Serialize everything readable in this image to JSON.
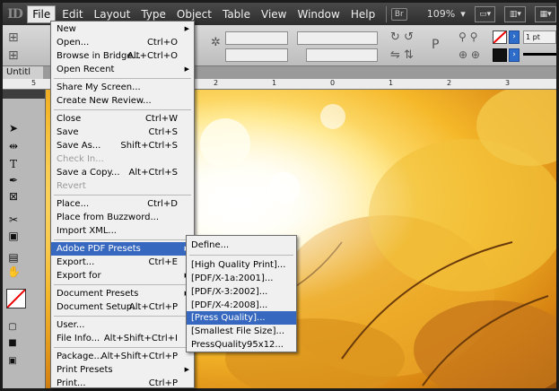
{
  "menubar": {
    "app_logo": "ID",
    "items": [
      "File",
      "Edit",
      "Layout",
      "Type",
      "Object",
      "Table",
      "View",
      "Window",
      "Help"
    ],
    "bridge_badge": "Br",
    "zoom": "109%",
    "stroke_weight": "1 pt"
  },
  "document": {
    "tab_title": "Untitl"
  },
  "ruler": {
    "labels": [
      "5",
      "2",
      "1",
      "0",
      "1",
      "2",
      "3"
    ]
  },
  "file_menu": {
    "items": [
      {
        "label": "New",
        "shortcut": "",
        "submenu": true,
        "disabled": false
      },
      {
        "label": "Open...",
        "shortcut": "Ctrl+O",
        "submenu": false,
        "disabled": false
      },
      {
        "label": "Browse in Bridge...",
        "shortcut": "Alt+Ctrl+O",
        "submenu": false,
        "disabled": false
      },
      {
        "label": "Open Recent",
        "shortcut": "",
        "submenu": true,
        "disabled": false
      },
      {
        "label": "Share My Screen...",
        "shortcut": "",
        "submenu": false,
        "disabled": false
      },
      {
        "label": "Create New Review...",
        "shortcut": "",
        "submenu": false,
        "disabled": false
      },
      {
        "label": "Close",
        "shortcut": "Ctrl+W",
        "submenu": false,
        "disabled": false
      },
      {
        "label": "Save",
        "shortcut": "Ctrl+S",
        "submenu": false,
        "disabled": false
      },
      {
        "label": "Save As...",
        "shortcut": "Shift+Ctrl+S",
        "submenu": false,
        "disabled": false
      },
      {
        "label": "Check In...",
        "shortcut": "",
        "submenu": false,
        "disabled": true
      },
      {
        "label": "Save a Copy...",
        "shortcut": "Alt+Ctrl+S",
        "submenu": false,
        "disabled": false
      },
      {
        "label": "Revert",
        "shortcut": "",
        "submenu": false,
        "disabled": true
      },
      {
        "label": "Place...",
        "shortcut": "Ctrl+D",
        "submenu": false,
        "disabled": false
      },
      {
        "label": "Place from Buzzword...",
        "shortcut": "",
        "submenu": false,
        "disabled": false
      },
      {
        "label": "Import XML...",
        "shortcut": "",
        "submenu": false,
        "disabled": false
      },
      {
        "label": "Adobe PDF Presets",
        "shortcut": "",
        "submenu": true,
        "disabled": false,
        "highlighted": true
      },
      {
        "label": "Export...",
        "shortcut": "Ctrl+E",
        "submenu": false,
        "disabled": false
      },
      {
        "label": "Export for",
        "shortcut": "",
        "submenu": true,
        "disabled": false
      },
      {
        "label": "Document Presets",
        "shortcut": "",
        "submenu": true,
        "disabled": false
      },
      {
        "label": "Document Setup...",
        "shortcut": "Alt+Ctrl+P",
        "submenu": false,
        "disabled": false
      },
      {
        "label": "User...",
        "shortcut": "",
        "submenu": false,
        "disabled": false
      },
      {
        "label": "File Info...",
        "shortcut": "Alt+Shift+Ctrl+I",
        "submenu": false,
        "disabled": false
      },
      {
        "label": "Package...",
        "shortcut": "Alt+Shift+Ctrl+P",
        "submenu": false,
        "disabled": false
      },
      {
        "label": "Print Presets",
        "shortcut": "",
        "submenu": true,
        "disabled": false
      },
      {
        "label": "Print...",
        "shortcut": "Ctrl+P",
        "submenu": false,
        "disabled": false
      }
    ]
  },
  "pdf_presets_menu": {
    "items": [
      {
        "label": "Define...",
        "highlighted": false
      },
      {
        "label": "[High Quality Print]...",
        "highlighted": false
      },
      {
        "label": "[PDF/X-1a:2001]...",
        "highlighted": false
      },
      {
        "label": "[PDF/X-3:2002]...",
        "highlighted": false
      },
      {
        "label": "[PDF/X-4:2008]...",
        "highlighted": false
      },
      {
        "label": "[Press Quality]...",
        "highlighted": true
      },
      {
        "label": "[Smallest File Size]...",
        "highlighted": false
      },
      {
        "label": "PressQuality95x12...",
        "highlighted": false
      }
    ]
  },
  "colors": {
    "highlight": "#3768bf",
    "menubar": "#2c2c2c"
  }
}
